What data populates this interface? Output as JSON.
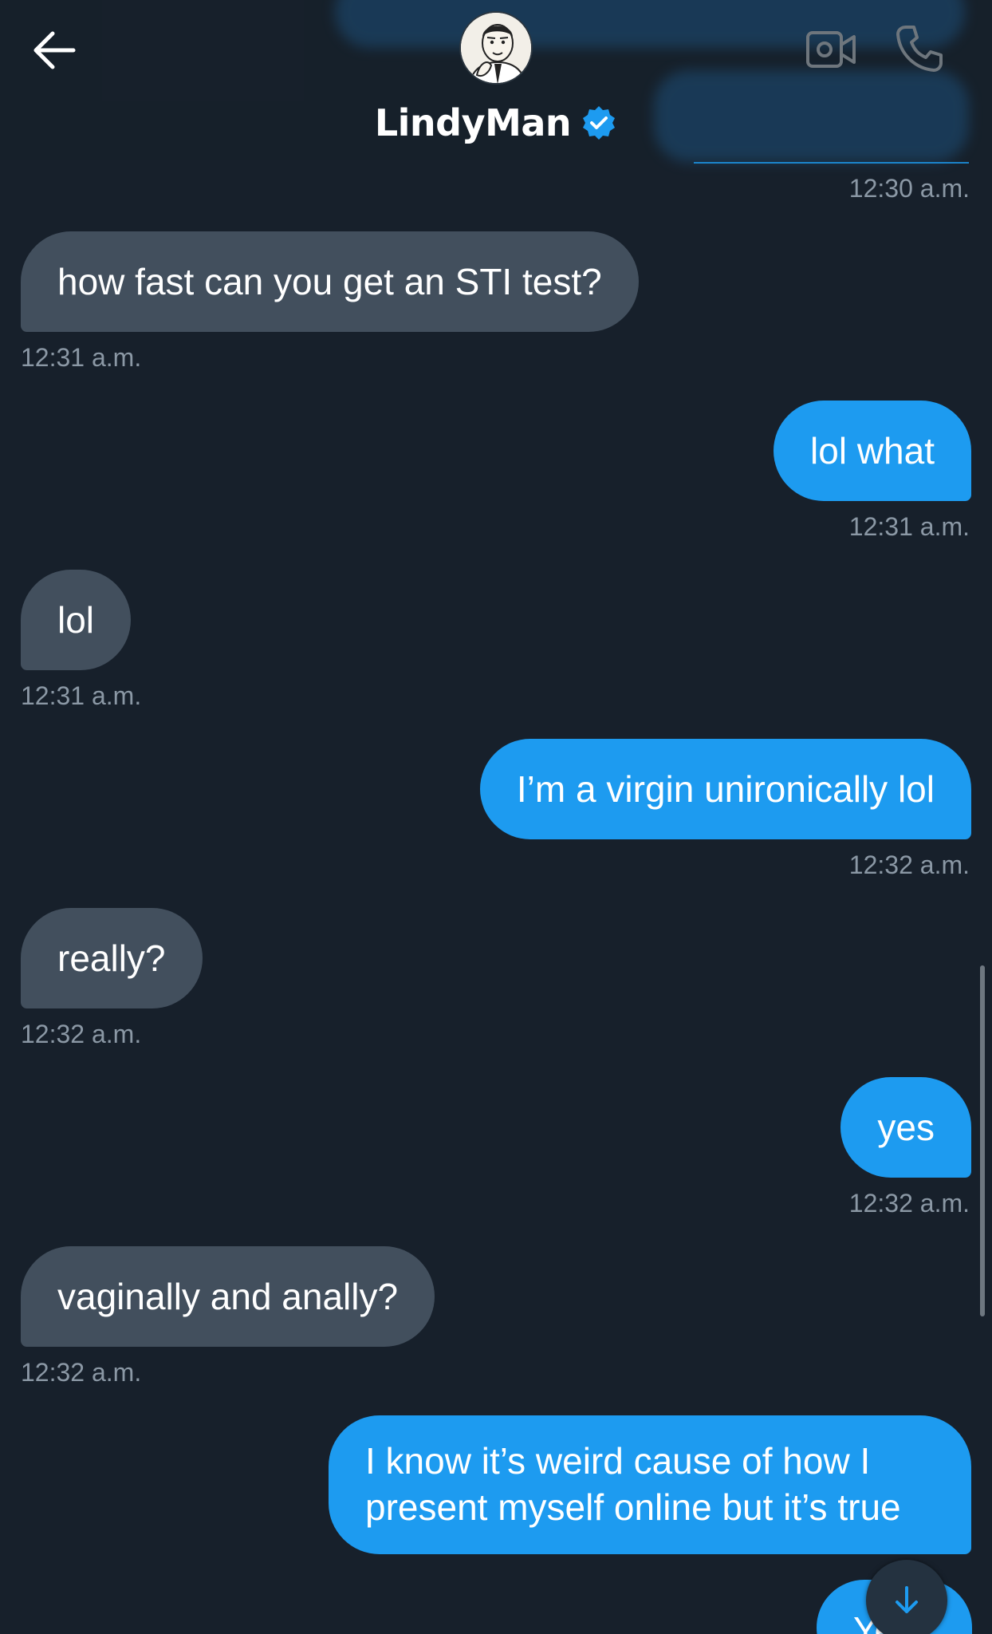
{
  "header": {
    "title": "LindyMan",
    "back_icon": "arrow-left-icon",
    "video_icon": "video-call-icon",
    "phone_icon": "phone-call-icon",
    "verified_icon": "verified-badge-icon"
  },
  "messages": [
    {
      "side": "out",
      "text": "",
      "time": "12:30 a.m."
    },
    {
      "side": "in",
      "text": "how fast can you get an STI test?",
      "time": "12:31 a.m."
    },
    {
      "side": "out",
      "text": "lol what",
      "time": "12:31 a.m."
    },
    {
      "side": "in",
      "text": "lol",
      "time": "12:31 a.m."
    },
    {
      "side": "out",
      "text": "I’m a virgin unironically lol",
      "time": "12:32 a.m."
    },
    {
      "side": "in",
      "text": "really?",
      "time": "12:32 a.m."
    },
    {
      "side": "out",
      "text": "yes",
      "time": "12:32 a.m."
    },
    {
      "side": "in",
      "text": "vaginally and anally?",
      "time": "12:32 a.m."
    },
    {
      "side": "out",
      "text": "I know it’s weird cause of how I present myself online but it’s true",
      "time": ""
    },
    {
      "side": "out",
      "text": "Ye",
      "time": ""
    }
  ],
  "colors": {
    "background": "#17202b",
    "incoming_bubble": "#424f5d",
    "outgoing_bubble": "#1d9bf0",
    "timestamp": "#8b98a5",
    "verified": "#1d9bf0"
  },
  "scroll_down_icon": "arrow-down-icon"
}
